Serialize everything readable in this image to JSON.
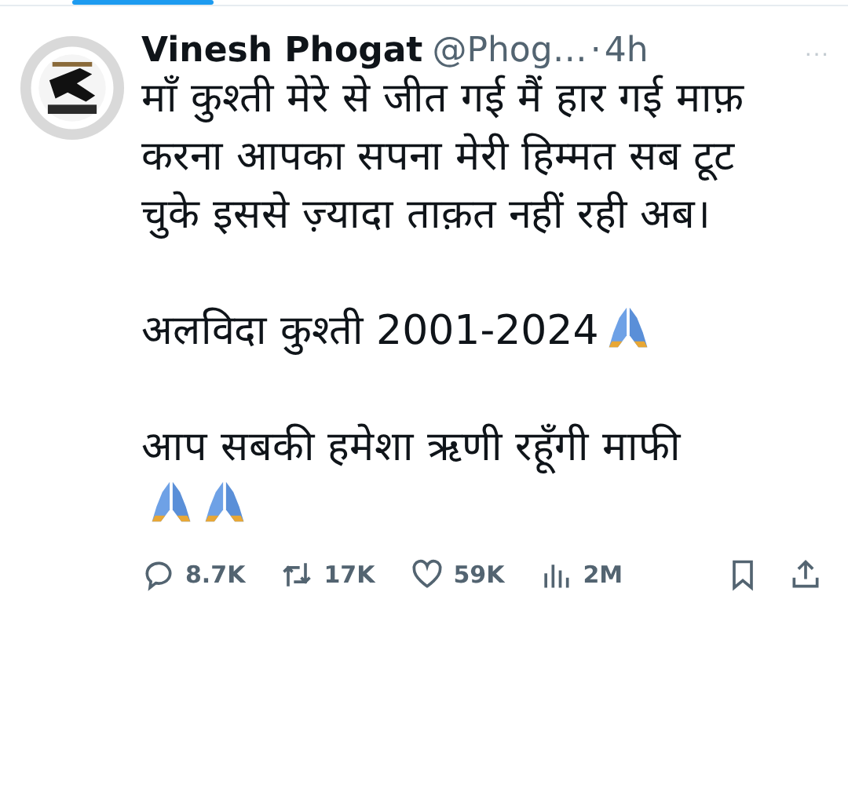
{
  "author": {
    "name": "Vinesh Phogat",
    "handle": "@Phog…",
    "separator": "·",
    "time": "4h",
    "more": "···"
  },
  "paragraphs": [
    {
      "parts": [
        {
          "kind": "text",
          "text": "माँ कुश्ती मेरे से जीत गई मैं हार गई माफ़ करना आपका सपना मेरी हिम्मत सब टूट चुके इससे ज़्यादा ताक़त नहीं रही अब।"
        }
      ]
    },
    {
      "parts": [
        {
          "kind": "text",
          "text": "अलविदा कुश्ती 2001-2024"
        },
        {
          "kind": "praying-hands"
        }
      ]
    },
    {
      "parts": [
        {
          "kind": "text",
          "text": "आप सबकी हमेशा ऋणी रहूँगी माफी"
        },
        {
          "kind": "break"
        },
        {
          "kind": "praying-hands"
        },
        {
          "kind": "praying-hands"
        }
      ]
    }
  ],
  "actions": [
    {
      "kind": "reply",
      "count": "8.7K"
    },
    {
      "kind": "repost",
      "count": "17K"
    },
    {
      "kind": "like",
      "count": "59K"
    },
    {
      "kind": "views",
      "count": "2M"
    },
    {
      "kind": "bookmark"
    },
    {
      "kind": "share"
    }
  ]
}
